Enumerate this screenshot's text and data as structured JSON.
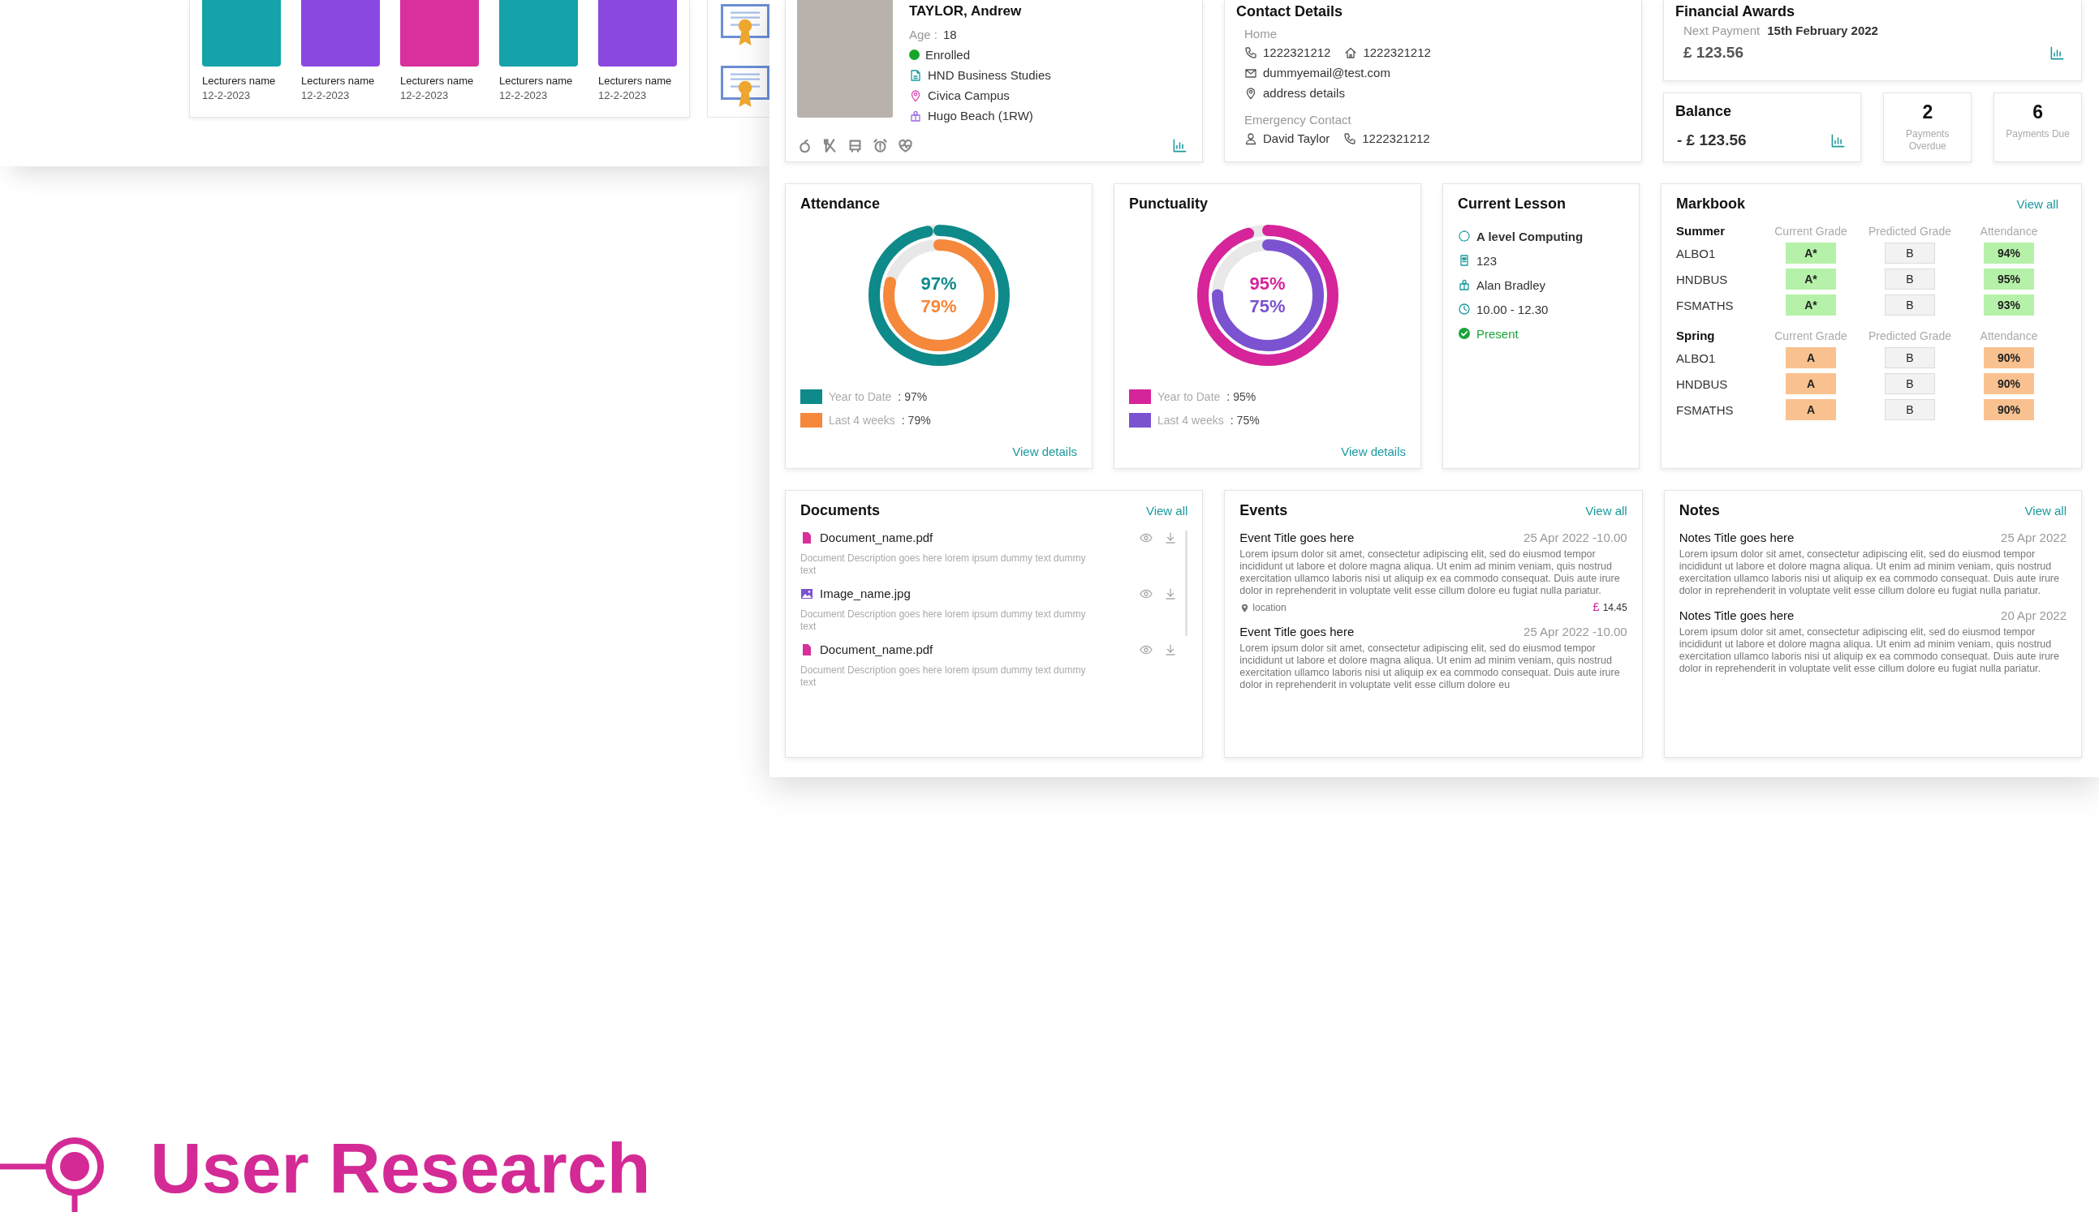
{
  "lecturers": [
    {
      "name": "Lecturers name",
      "date": "12-2-2023",
      "color": "#13a3a8"
    },
    {
      "name": "Lecturers name",
      "date": "12-2-2023",
      "color": "#8a48e0"
    },
    {
      "name": "Lecturers name",
      "date": "12-2-2023",
      "color": "#d8309c"
    },
    {
      "name": "Lecturers name",
      "date": "12-2-2023",
      "color": "#13a3a8"
    },
    {
      "name": "Lecturers name",
      "date": "12-2-2023",
      "color": "#8a48e0"
    }
  ],
  "profile": {
    "name": "TAYLOR, Andrew",
    "age_label": "Age :",
    "age": "18",
    "status": "Enrolled",
    "enrolled": true,
    "course": "HND Business Studies",
    "campus": "Civica Campus",
    "tutor": "Hugo Beach (1RW)"
  },
  "contact": {
    "title": "Contact Details",
    "home_label": "Home",
    "phone": "1222321212",
    "home_phone": "1222321212",
    "email": "dummyemail@test.com",
    "address": "address details",
    "emergency_label": "Emergency Contact",
    "emergency_name": "David Taylor",
    "emergency_phone": "1222321212"
  },
  "financial": {
    "title": "Financial Awards",
    "next_label": "Next Payment",
    "next_date": "15th February 2022",
    "amount": "£ 123.56"
  },
  "balance": {
    "title": "Balance",
    "amount": "- £ 123.56"
  },
  "payment_stats": [
    {
      "count": "2",
      "label": "Payments Overdue"
    },
    {
      "count": "6",
      "label": "Payments Due"
    }
  ],
  "attendance": {
    "title": "Attendance",
    "link": "View details",
    "rings": [
      {
        "label": "Year to Date",
        "separator": ":",
        "value": "97%",
        "center": "97%",
        "level": 0.97,
        "color": "#0e8a8a"
      },
      {
        "label": "Last 4 weeks",
        "separator": ":",
        "value": "79%",
        "center": "79%",
        "level": 0.79,
        "color": "#f5883a"
      }
    ]
  },
  "punctuality": {
    "title": "Punctuality",
    "link": "View details",
    "rings": [
      {
        "label": "Year to Date",
        "separator": ":",
        "value": "95%",
        "center": "95%",
        "level": 0.95,
        "color": "#d6249a"
      },
      {
        "label": "Last 4 weeks",
        "separator": ":",
        "value": "75%",
        "center": "75%",
        "level": 0.75,
        "color": "#7b52d0"
      }
    ]
  },
  "current_lesson": {
    "title": "Current Lesson",
    "subject": "A level Computing",
    "room": "123",
    "teacher": "Alan Bradley",
    "time": "10.00 - 12.30",
    "status": "Present",
    "present": true
  },
  "markbook": {
    "title": "Markbook",
    "link": "View all",
    "terms": [
      {
        "name": "Summer",
        "columns": [
          "Current Grade",
          "Predicted Grade",
          "Attendance"
        ],
        "rows": [
          {
            "course": "ALBO1",
            "current": "A*",
            "predicted": "B",
            "attendance": "94%",
            "color": "#b6f1a9"
          },
          {
            "course": "HNDBUS",
            "current": "A*",
            "predicted": "B",
            "attendance": "95%",
            "color": "#b6f1a9"
          },
          {
            "course": "FSMATHS",
            "current": "A*",
            "predicted": "B",
            "attendance": "93%",
            "color": "#b6f1a9"
          }
        ]
      },
      {
        "name": "Spring",
        "columns": [
          "Current Grade",
          "Predicted Grade",
          "Attendance"
        ],
        "rows": [
          {
            "course": "ALBO1",
            "current": "A",
            "predicted": "B",
            "attendance": "90%",
            "color": "#f9c18f"
          },
          {
            "course": "HNDBUS",
            "current": "A",
            "predicted": "B",
            "attendance": "90%",
            "color": "#f9c18f"
          },
          {
            "course": "FSMATHS",
            "current": "A",
            "predicted": "B",
            "attendance": "90%",
            "color": "#f9c18f"
          }
        ]
      }
    ]
  },
  "documents": {
    "title": "Documents",
    "link": "View all",
    "items": [
      {
        "kind": "pdf",
        "name": "Document_name.pdf",
        "description": "Document Description goes here lorem ipsum dummy text dummy text"
      },
      {
        "kind": "image",
        "name": "Image_name.jpg",
        "description": "Document Description goes here lorem ipsum dummy text dummy text"
      },
      {
        "kind": "pdf",
        "name": "Document_name.pdf",
        "description": "Document Description goes here lorem ipsum dummy text dummy text"
      }
    ]
  },
  "events": {
    "title": "Events",
    "link": "View all",
    "items": [
      {
        "title": "Event Title goes here",
        "date": "25 Apr 2022 -10.00",
        "body": "Lorem ipsum dolor sit amet, consectetur adipiscing elit, sed do eiusmod tempor incididunt ut labore et dolore magna aliqua. Ut enim ad minim veniam, quis nostrud exercitation ullamco laboris nisi ut aliquip ex ea commodo consequat. Duis aute irure dolor in reprehenderit in voluptate velit esse cillum dolore eu fugiat nulla pariatur.",
        "location": "location",
        "currency": "£",
        "price": "14.45"
      },
      {
        "title": "Event Title goes here",
        "date": "25 Apr 2022 -10.00",
        "body": "Lorem ipsum dolor sit amet, consectetur adipiscing elit, sed do eiusmod tempor incididunt ut labore et dolore magna aliqua. Ut enim ad minim veniam, quis nostrud exercitation ullamco laboris nisi ut aliquip ex ea commodo consequat. Duis aute irure dolor in reprehenderit in voluptate velit esse cillum dolore eu"
      }
    ]
  },
  "notes": {
    "title": "Notes",
    "link": "View all",
    "items": [
      {
        "title": "Notes Title goes here",
        "date": "25 Apr 2022",
        "body": "Lorem ipsum dolor sit amet, consectetur adipiscing elit, sed do eiusmod tempor incididunt ut labore et dolore magna aliqua. Ut enim ad minim veniam, quis nostrud exercitation ullamco laboris nisi ut aliquip ex ea commodo consequat. Duis aute irure dolor in reprehenderit in voluptate velit esse cillum dolore eu fugiat nulla pariatur."
      },
      {
        "title": "Notes Title goes here",
        "date": "20 Apr 2022",
        "body": "Lorem ipsum dolor sit amet, consectetur adipiscing elit, sed do eiusmod tempor incididunt ut labore et dolore magna aliqua. Ut enim ad minim veniam, quis nostrud exercitation ullamco laboris nisi ut aliquip ex ea commodo consequat. Duis aute irure dolor in reprehenderit in voluptate velit esse cillum dolore eu fugiat nulla pariatur."
      }
    ]
  },
  "section_heading": {
    "text": "User Research"
  }
}
